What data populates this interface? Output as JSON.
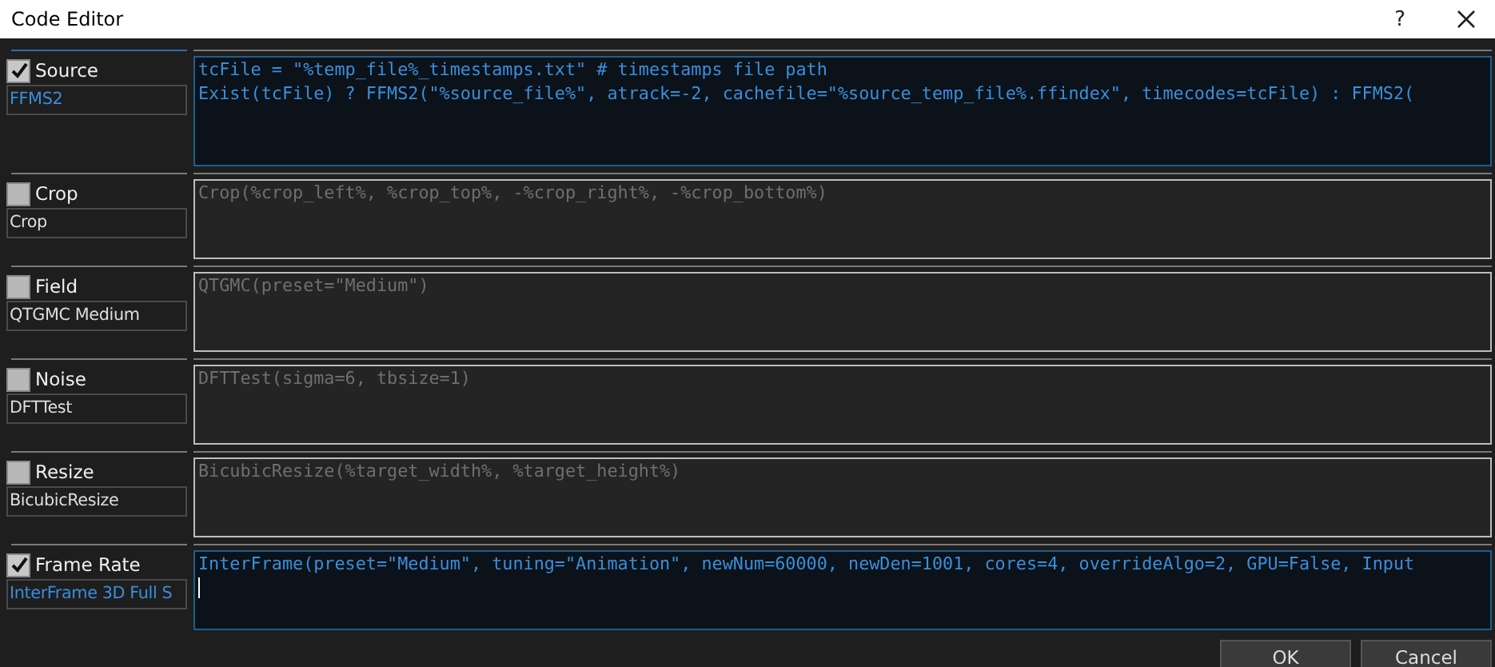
{
  "window": {
    "title": "Code Editor",
    "help": "?"
  },
  "filters": [
    {
      "category": "Source",
      "checked": true,
      "name": "FFMS2",
      "code": [
        "tcFile = \"%temp_file%_timestamps.txt\" # timestamps file path",
        "Exist(tcFile) ? FFMS2(\"%source_file%\", atrack=-2, cachefile=\"%source_temp_file%.ffindex\", timecodes=tcFile) : FFMS2("
      ]
    },
    {
      "category": "Crop",
      "checked": false,
      "name": "Crop",
      "code": [
        "Crop(%crop_left%, %crop_top%, -%crop_right%, -%crop_bottom%)"
      ]
    },
    {
      "category": "Field",
      "checked": false,
      "name": "QTGMC Medium",
      "code": [
        "QTGMC(preset=\"Medium\")"
      ]
    },
    {
      "category": "Noise",
      "checked": false,
      "name": "DFTTest",
      "code": [
        "DFTTest(sigma=6, tbsize=1)"
      ]
    },
    {
      "category": "Resize",
      "checked": false,
      "name": "BicubicResize",
      "code": [
        "BicubicResize(%target_width%, %target_height%)"
      ]
    },
    {
      "category": "Frame Rate",
      "checked": true,
      "name": "InterFrame 3D Full S",
      "code": [
        "InterFrame(preset=\"Medium\", tuning=\"Animation\", newNum=60000, newDen=1001, cores=4, overrideAlgo=2, GPU=False, Input"
      ]
    }
  ],
  "buttons": [
    "OK",
    "Cancel"
  ]
}
